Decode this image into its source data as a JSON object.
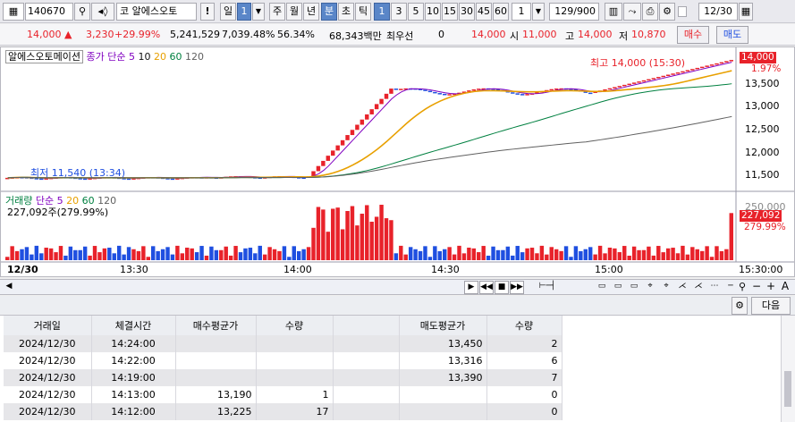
{
  "toolbar": {
    "code": "140670",
    "stock_name": "알에스오토",
    "tag_code": "코",
    "exclaim": "!",
    "period_buttons": [
      "일",
      "1",
      "주",
      "월",
      "년",
      "분",
      "초",
      "틱",
      "1",
      "3",
      "5",
      "10",
      "15",
      "30",
      "45",
      "60",
      "1"
    ],
    "count": "129/900",
    "date": "12/30"
  },
  "quote": {
    "price": "14,000",
    "change": "3,230",
    "change_pct": "+29.99%",
    "volume": "5,241,529",
    "volume_pct": "7,039.48%",
    "turnover": "56.34%",
    "amount": "68,343백만",
    "broker": "최우선",
    "broker_val": "0",
    "best": "14,000",
    "open_label": "시",
    "open": "11,000",
    "high_label": "고",
    "high": "14,000",
    "low_label": "저",
    "low": "10,870",
    "buy": "매수",
    "sell": "매도"
  },
  "chart_top": {
    "name": "알에스오토메이션",
    "legend_label": "종가 단순",
    "ma": [
      "5",
      "10",
      "20",
      "60",
      "120"
    ],
    "ma_colors": [
      "#8000c0",
      "#101010",
      "#e8a000",
      "#008040",
      "#606060"
    ],
    "y_ticks": [
      "13,500",
      "13,000",
      "12,500",
      "12,000",
      "11,500"
    ],
    "high_note": "최고 14,000 (15:30)",
    "low_note": "최저 11,540 (13:34)",
    "price_tag": "14,000",
    "pct_tag": "1.97%"
  },
  "chart_vol": {
    "legend_label": "거래량",
    "legend_ma_label": "단순",
    "ma": [
      "5",
      "20",
      "60",
      "120"
    ],
    "current": "227,092주(279.99%)",
    "y_tick": "250,000",
    "vol_tag": "227,092",
    "pct_tag": "279.99%"
  },
  "x_axis": {
    "date": "12/30",
    "ticks": [
      "13:30",
      "14:00",
      "14:30",
      "15:00",
      "15:30:00"
    ]
  },
  "trade_panel": {
    "next_btn": "다음",
    "headers": [
      "거래일",
      "체결시간",
      "매수평균가",
      "수량",
      "",
      "매도평균가",
      "수량"
    ],
    "rows": [
      [
        "2024/12/30",
        "14:24:00",
        "",
        "",
        "",
        "13,450",
        "2"
      ],
      [
        "2024/12/30",
        "14:22:00",
        "",
        "",
        "",
        "13,316",
        "6"
      ],
      [
        "2024/12/30",
        "14:19:00",
        "",
        "",
        "",
        "13,390",
        "7"
      ],
      [
        "2024/12/30",
        "14:13:00",
        "13,190",
        "1",
        "",
        "",
        "0"
      ],
      [
        "2024/12/30",
        "14:12:00",
        "13,225",
        "17",
        "",
        "",
        "0"
      ]
    ]
  },
  "chart_data": {
    "type": "candlestick-volume",
    "title": "알에스오토메이션",
    "timeframe": "1분",
    "y_range": [
      11350,
      14150
    ],
    "x_ticks": [
      "13:30",
      "14:00",
      "14:30",
      "15:00",
      "15:30"
    ],
    "high": 14000,
    "low": 11540,
    "current": 14000,
    "volume_current": 227092
  }
}
